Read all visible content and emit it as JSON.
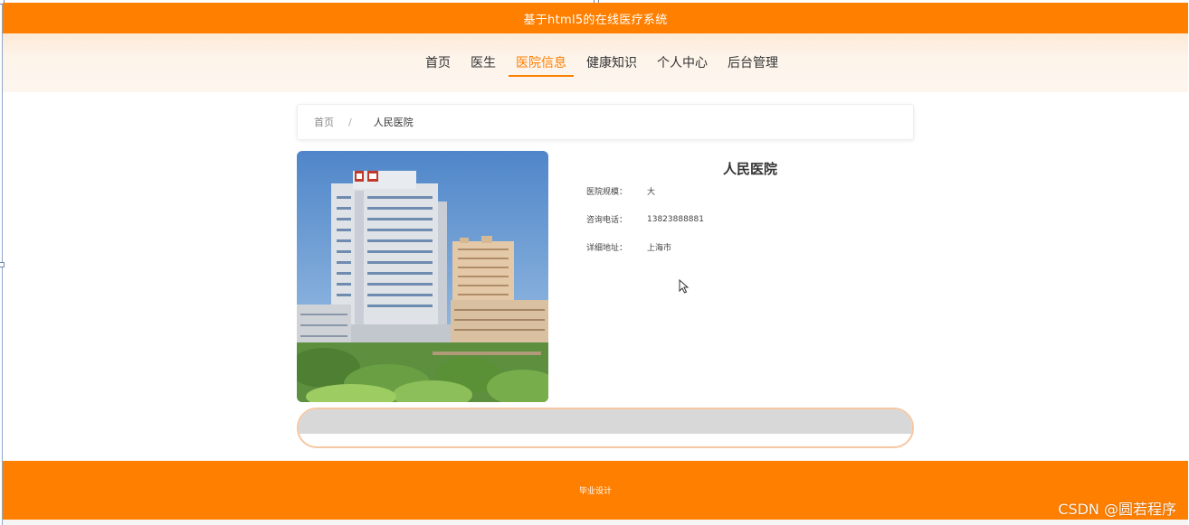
{
  "site": {
    "title": "基于html5的在线医疗系统"
  },
  "nav": {
    "items": [
      {
        "label": "首页",
        "active": false
      },
      {
        "label": "医生",
        "active": false
      },
      {
        "label": "医院信息",
        "active": true
      },
      {
        "label": "健康知识",
        "active": false
      },
      {
        "label": "个人中心",
        "active": false
      },
      {
        "label": "后台管理",
        "active": false
      }
    ]
  },
  "breadcrumb": {
    "home": "首页",
    "separator": "/",
    "current": "人民医院"
  },
  "hospital": {
    "name": "人民医院",
    "fields": [
      {
        "label": "医院规模：",
        "value": "大"
      },
      {
        "label": "咨询电话：",
        "value": "13823888881"
      },
      {
        "label": "详细地址：",
        "value": "上海市"
      }
    ]
  },
  "footer": {
    "text": "毕业设计"
  },
  "watermark": {
    "text": "CSDN @圆若程序"
  },
  "colors": {
    "accent": "#ff7f00",
    "nav_bg": "#fdf4ea",
    "action_border": "#f6c7a3",
    "action_fill": "#d8d8d8"
  }
}
